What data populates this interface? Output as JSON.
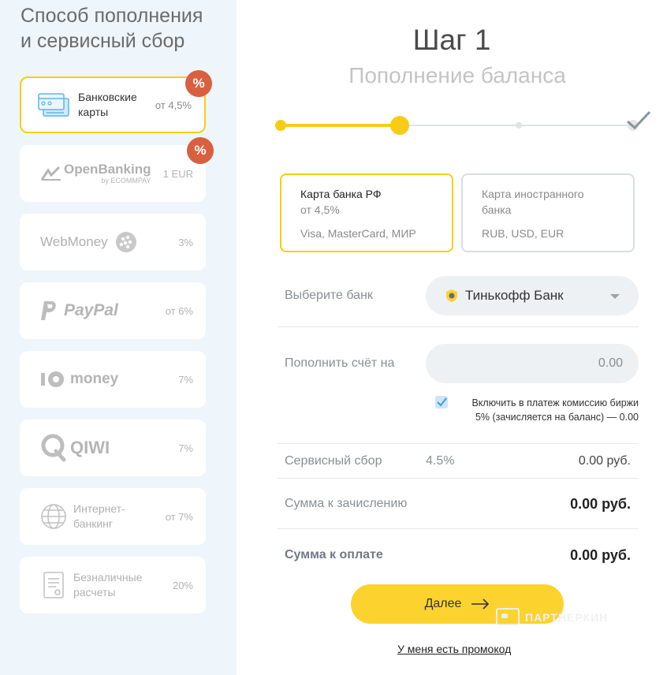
{
  "sidebar": {
    "title_line1": "Способ пополнения",
    "title_line2": "и сервисный сбор",
    "methods": [
      {
        "line1": "Банковские",
        "line2": "карты",
        "fee": "от 4,5%",
        "badge": "%"
      },
      {
        "logo": "OpenBanking",
        "sublogo": "by ECOMMPAY",
        "fee": "1 EUR",
        "badge": "%"
      },
      {
        "logo": "WebMoney",
        "fee": "3%"
      },
      {
        "logo": "PayPal",
        "fee": "от 6%"
      },
      {
        "logo": "money",
        "fee": "7%"
      },
      {
        "logo": "QIWI",
        "fee": "7%"
      },
      {
        "line1": "Интернет-",
        "line2": "банкинг",
        "fee": "от 7%"
      },
      {
        "line1": "Безналичные",
        "line2": "расчеты",
        "fee": "20%"
      }
    ]
  },
  "step": {
    "title": "Шаг 1",
    "subtitle": "Пополнение баланса"
  },
  "card_options": [
    {
      "title": "Карта банка РФ",
      "fee": "от 4,5%",
      "systems": "Visa, MasterCard, МИР"
    },
    {
      "title_line1": "Карта иностранного",
      "title_line2": "банка",
      "currencies": "RUB, USD, EUR"
    }
  ],
  "form": {
    "bank_label": "Выберите банк",
    "bank_value": "Тинькофф Банк",
    "amount_label": "Пополнить счёт на",
    "amount_placeholder": "0.00",
    "commission_line1": "Включить в платеж комиссию биржи",
    "commission_line2": "5% (зачисляется на баланс) — 0.00",
    "service_fee_label": "Сервисный сбор",
    "service_fee_pct": "4.5%",
    "service_fee_value": "0.00 руб.",
    "credit_label": "Сумма к зачислению",
    "credit_value": "0.00 руб.",
    "pay_label": "Сумма к оплате",
    "pay_value": "0.00 руб."
  },
  "actions": {
    "next_label": "Далее",
    "promo_label": "У меня есть промокод"
  },
  "watermark": "ПАРТНЕРКИН",
  "colors": {
    "accent": "#f8cc16",
    "badge": "#d9603f",
    "sidebar_bg": "#eef5fb"
  }
}
